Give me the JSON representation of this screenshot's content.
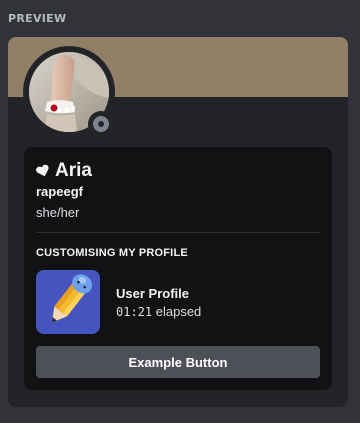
{
  "preview": {
    "label": "PREVIEW"
  },
  "profile": {
    "banner_color": "#8f8067",
    "display_name": "Aria",
    "username": "rapeegf",
    "pronouns": "she/her",
    "status": "offline",
    "status_color": "#80848e",
    "name_icon": "white-heart-icon"
  },
  "activity": {
    "section_title": "CUSTOMISING MY PROFILE",
    "name": "User Profile",
    "elapsed_time": "01:21",
    "elapsed_suffix": "elapsed",
    "icon": "pencil-icon",
    "icon_bg_color": "#4654c0"
  },
  "button": {
    "label": "Example Button"
  },
  "colors": {
    "page_bg": "#313338",
    "card_bg": "#232428",
    "inner_bg": "#111214",
    "button_bg": "#4e5058"
  }
}
